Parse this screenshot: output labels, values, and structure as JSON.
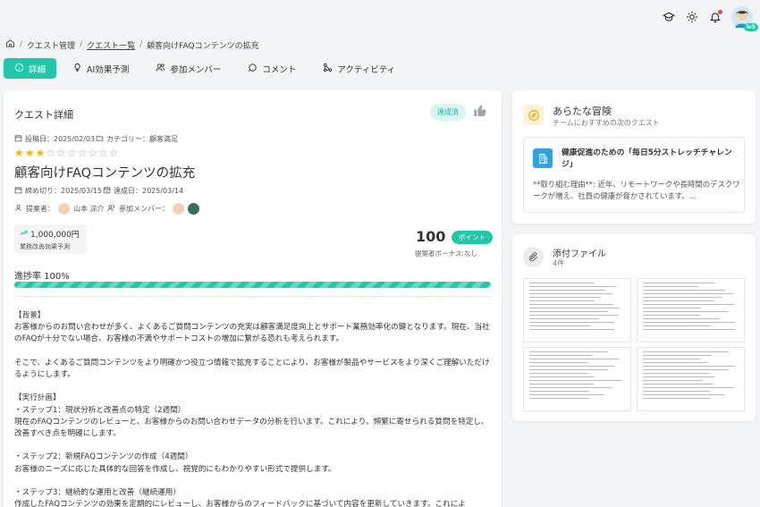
{
  "header": {
    "icons": [
      "graduation-cap-icon",
      "sun-icon",
      "bell-icon"
    ],
    "user_level": "lv5"
  },
  "breadcrumb": [
    "クエスト管理",
    "クエスト一覧",
    "顧客向けFAQコンテンツの拡充"
  ],
  "tabs": [
    {
      "label": "詳細",
      "icon": "info-icon",
      "active": true
    },
    {
      "label": "AI効果予測",
      "icon": "lightbulb-icon"
    },
    {
      "label": "参加メンバー",
      "icon": "users-icon"
    },
    {
      "label": "コメント",
      "icon": "chat-icon"
    },
    {
      "label": "アクティビティ",
      "icon": "activity-icon"
    }
  ],
  "quest": {
    "card_title": "クエスト詳細",
    "status": "達成済",
    "posted": "投稿日：2025/02/03",
    "category": "カテゴリー：顧客満足",
    "rating": 3,
    "rating_max": 10,
    "title": "顧客向けFAQコンテンツの拡充",
    "deadline": "締め切り：2025/03/15",
    "achieved": "達成日：2025/03/14",
    "proposer_label": "提案者：",
    "proposer": "山本 涼介",
    "members_label": "参加メンバー：",
    "effect_value": "1,000,000円",
    "effect_label": "業務改善効果予測",
    "points": "100",
    "points_badge": "ポイント",
    "bonus": "提案者ボーナス:なし",
    "progress_label": "進捗率 100%",
    "progress": 1.0,
    "description": "【背景】\nお客様からのお問い合わせが多く、よくあるご質問コンテンツの充実は顧客満足度向上とサポート業務効率化の鍵となります。現在、当社のFAQが十分でない場合、お客様の不満やサポートコストの増加に繋がる恐れも考えられます。\n\nそこで、よくあるご質問コンテンツをより明確かつ役立つ情報で拡充することにより、お客様が製品やサービスをより深くご理解いただけるようにします。\n\n【実行計画】\n・ステップ1：現状分析と改善点の特定（2週間）\n現在のFAQコンテンツのレビューと、お客様からのお問い合わせデータの分析を行います。これにより、頻繁に寄せられる質問を特定し、改善すべき点を明確にします。\n\n・ステップ2：新規FAQコンテンツの作成（4週間）\nお客様のニーズに応じた具体的な回答を作成し、視覚的にもわかりやすい形式で提供します。\n\n・ステップ3：継続的な運用と改善（継続運用）\n作成したFAQコンテンツの効果を定期的にレビューし、お客様からのフィードバックに基づいて内容を更新していきます。これによ"
  },
  "adventure": {
    "title": "あらたな冒険",
    "subtitle": "チームにおすすめの次のクエスト",
    "rec_title": "健康促進のための「毎日5分ストレッチチャレンジ」",
    "rec_body": "**取り組む理由**: 近年、リモートワークや長時間のデスクワークが増え、社員の健康が脅かされています。…"
  },
  "attachments": {
    "title": "添付ファイル",
    "count": "4件"
  }
}
